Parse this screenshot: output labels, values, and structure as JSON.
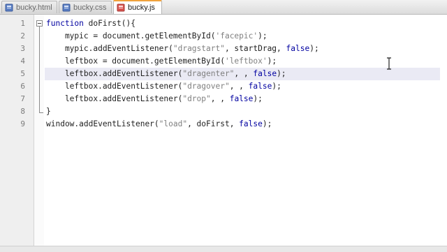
{
  "tabs": [
    {
      "label": "bucky.html",
      "icon": "file-icon",
      "active": false
    },
    {
      "label": "bucky.css",
      "icon": "file-icon",
      "active": false
    },
    {
      "label": "bucky.js",
      "icon": "file-icon",
      "active": true
    }
  ],
  "line_numbers": [
    "1",
    "2",
    "3",
    "4",
    "5",
    "6",
    "7",
    "8",
    "9"
  ],
  "code": {
    "l1_kw": "function",
    "l1_rest": " doFirst(){",
    "l2_a": "    mypic = document.getElementById(",
    "l2_s": "'facepic'",
    "l2_b": ");",
    "l3_a": "    mypic.addEventListener(",
    "l3_s": "\"dragstart\"",
    "l3_b": ", startDrag, ",
    "l3_kw": "false",
    "l3_c": ");",
    "l4_a": "    leftbox = document.getElementById(",
    "l4_s": "'leftbox'",
    "l4_b": ");",
    "l5_a": "    leftbox.addEventListener(",
    "l5_s": "\"dragenter\"",
    "l5_b": ", , ",
    "l5_kw": "false",
    "l5_c": ");",
    "l6_a": "    leftbox.addEventListener(",
    "l6_s": "\"dragover\"",
    "l6_b": ", , ",
    "l6_kw": "false",
    "l6_c": ");",
    "l7_a": "    leftbox.addEventListener(",
    "l7_s": "\"drop\"",
    "l7_b": ", , ",
    "l7_kw": "false",
    "l7_c": ");",
    "l8": "}",
    "l9_a": "window.addEventListener(",
    "l9_s": "\"load\"",
    "l9_b": ", doFirst, ",
    "l9_kw": "false",
    "l9_c": ");"
  },
  "colors": {
    "keyword": "#0000a0",
    "string": "#808080",
    "active_tab_accent": "#f0a23c"
  }
}
